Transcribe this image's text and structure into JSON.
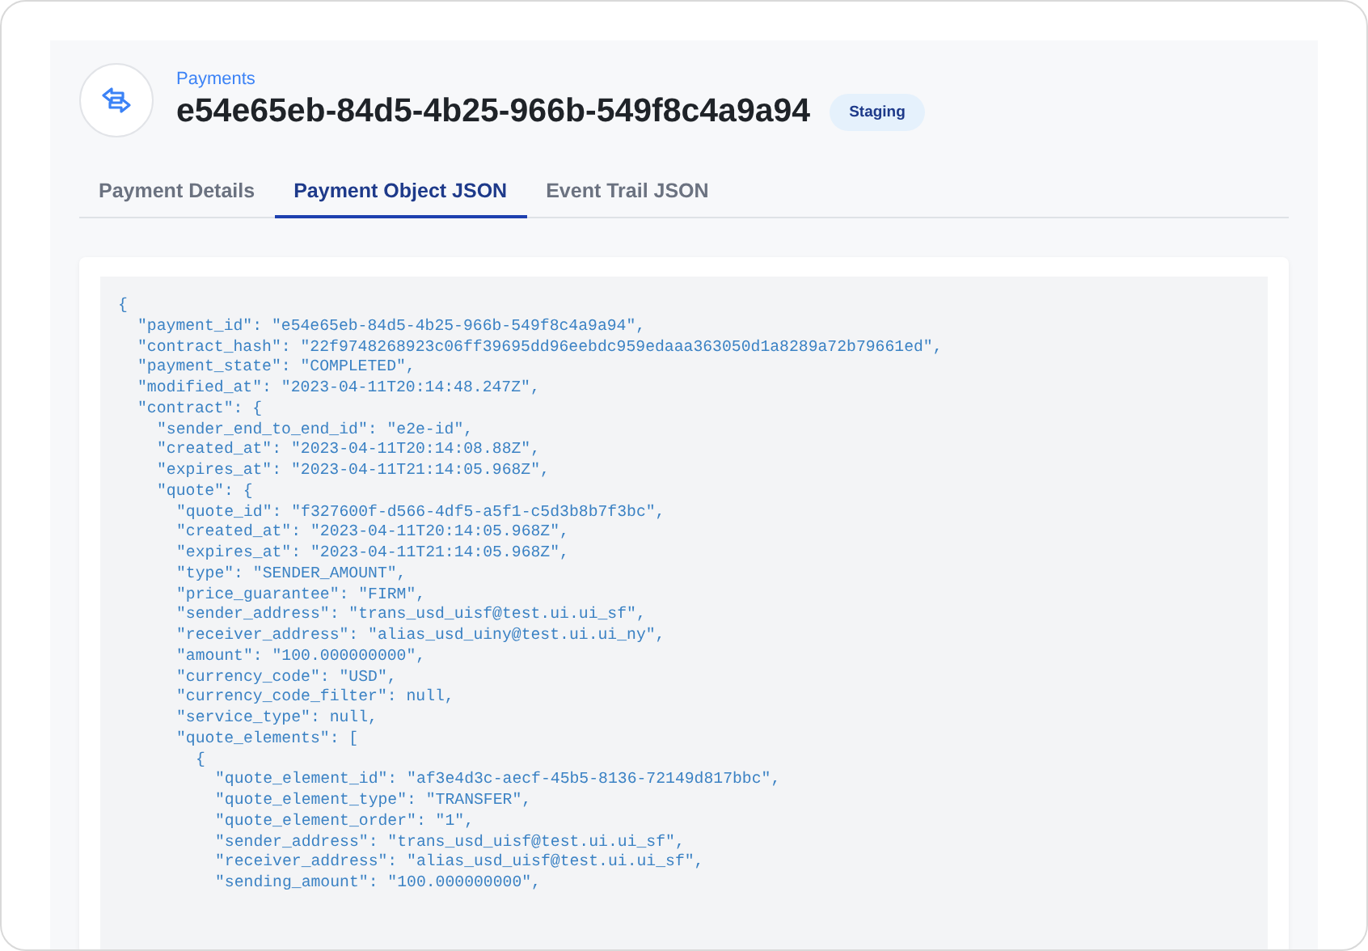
{
  "header": {
    "breadcrumb": "Payments",
    "title": "e54e65eb-84d5-4b25-966b-549f8c4a9a94",
    "badge": "Staging"
  },
  "tabs": [
    {
      "label": "Payment Details",
      "selected": false
    },
    {
      "label": "Payment Object JSON",
      "selected": true
    },
    {
      "label": "Event Trail JSON",
      "selected": false
    }
  ],
  "code": [
    {
      "text": "{",
      "children": [
        {
          "text": "\"payment_id\": \"e54e65eb-84d5-4b25-966b-549f8c4a9a94\","
        },
        {
          "text": "\"contract_hash\": \"22f9748268923c06ff39695dd96eebdc959edaaa363050d1a8289a72b79661ed\","
        },
        {
          "text": "\"payment_state\": \"COMPLETED\","
        },
        {
          "text": "\"modified_at\": \"2023-04-11T20:14:48.247Z\","
        },
        {
          "text": "\"contract\": {",
          "children": [
            {
              "text": "\"sender_end_to_end_id\": \"e2e-id\","
            },
            {
              "text": "\"created_at\": \"2023-04-11T20:14:08.88Z\","
            },
            {
              "text": "\"expires_at\": \"2023-04-11T21:14:05.968Z\","
            },
            {
              "text": "\"quote\": {",
              "children": [
                {
                  "text": "\"quote_id\": \"f327600f-d566-4df5-a5f1-c5d3b8b7f3bc\","
                },
                {
                  "text": "\"created_at\": \"2023-04-11T20:14:05.968Z\","
                },
                {
                  "text": "\"expires_at\": \"2023-04-11T21:14:05.968Z\","
                },
                {
                  "text": "\"type\": \"SENDER_AMOUNT\","
                },
                {
                  "text": "\"price_guarantee\": \"FIRM\","
                },
                {
                  "text": "\"sender_address\": \"trans_usd_uisf@test.ui.ui_sf\","
                },
                {
                  "text": "\"receiver_address\": \"alias_usd_uiny@test.ui.ui_ny\","
                },
                {
                  "text": "\"amount\": \"100.000000000\","
                },
                {
                  "text": "\"currency_code\": \"USD\","
                },
                {
                  "text": "\"currency_code_filter\": null,"
                },
                {
                  "text": "\"service_type\": null,"
                },
                {
                  "text": "\"quote_elements\": [",
                  "children": [
                    {
                      "text": "{",
                      "children": [
                        {
                          "text": "\"quote_element_id\": \"af3e4d3c-aecf-45b5-8136-72149d817bbc\","
                        },
                        {
                          "text": "\"quote_element_type\": \"TRANSFER\","
                        },
                        {
                          "text": "\"quote_element_order\": \"1\","
                        },
                        {
                          "text": "\"sender_address\": \"trans_usd_uisf@test.ui.ui_sf\","
                        },
                        {
                          "text": "\"receiver_address\": \"alias_usd_uisf@test.ui.ui_sf\","
                        },
                        {
                          "text": "\"sending_amount\": \"100.000000000\","
                        }
                      ]
                    }
                  ]
                }
              ]
            }
          ]
        }
      ]
    }
  ]
}
